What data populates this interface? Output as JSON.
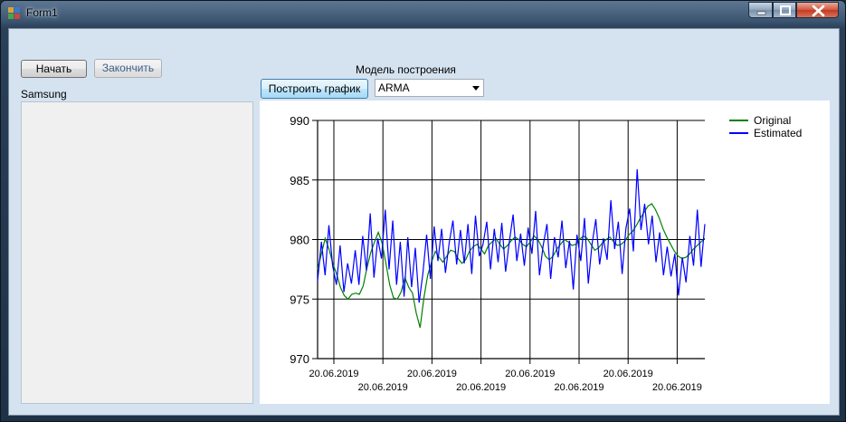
{
  "window": {
    "title": "Form1"
  },
  "buttons": {
    "start": "Начать",
    "finish": "Закончить",
    "plot": "Построить график"
  },
  "labels": {
    "list_title": "Samsung",
    "model_label": "Модель построения"
  },
  "model_select": {
    "value": "ARMA"
  },
  "colors": {
    "original": "#008000",
    "estimated": "#0000ff"
  },
  "chart_data": {
    "type": "line",
    "ylim": [
      970,
      990
    ],
    "yticks": [
      "970",
      "975",
      "980",
      "985",
      "990"
    ],
    "xtick_labels": [
      "20.06.2019",
      "20.06.2019",
      "20.06.2019",
      "20.06.2019",
      "20.06.2019",
      "20.06.2019",
      "20.06.2019",
      "20.06.2019"
    ],
    "legend": [
      "Original",
      "Estimated"
    ],
    "legend_position": "top-right",
    "grid": true,
    "series": [
      {
        "name": "Original",
        "values": [
          977.5,
          978.8,
          980.1,
          979.2,
          978.0,
          977.1,
          976.0,
          975.3,
          975.0,
          975.4,
          975.5,
          975.4,
          976.1,
          977.6,
          978.9,
          979.8,
          980.6,
          979.7,
          978.0,
          976.2,
          975.1,
          975.0,
          975.6,
          976.8,
          976.0,
          975.5,
          973.8,
          972.6,
          975.1,
          977.0,
          978.1,
          979.0,
          978.5,
          978.1,
          978.6,
          979.1,
          979.0,
          978.4,
          978.0,
          978.3,
          979.0,
          979.4,
          979.6,
          979.2,
          978.8,
          979.5,
          979.8,
          980.1,
          979.6,
          979.2,
          979.5,
          979.9,
          980.2,
          980.0,
          979.6,
          979.4,
          979.8,
          980.3,
          980.0,
          979.4,
          978.6,
          978.3,
          978.6,
          979.2,
          979.6,
          980.0,
          979.8,
          979.5,
          979.6,
          980.0,
          980.3,
          980.1,
          979.6,
          979.1,
          979.3,
          979.7,
          980.0,
          980.2,
          979.8,
          979.5,
          979.6,
          979.9,
          980.4,
          980.7,
          981.2,
          981.8,
          982.3,
          982.8,
          983.0,
          982.5,
          981.8,
          980.9,
          980.2,
          979.6,
          979.0,
          978.6,
          978.4,
          978.5,
          978.8,
          979.2,
          979.5,
          979.8,
          980.1
        ]
      },
      {
        "name": "Estimated",
        "values": [
          976.5,
          979.8,
          977.0,
          981.2,
          977.8,
          976.2,
          979.5,
          975.6,
          978.0,
          976.3,
          979.1,
          976.2,
          980.3,
          977.4,
          982.2,
          976.8,
          980.1,
          978.4,
          982.5,
          977.5,
          981.6,
          976.2,
          979.8,
          975.2,
          980.2,
          976.0,
          979.3,
          974.7,
          977.1,
          980.4,
          976.7,
          981.1,
          978.2,
          980.9,
          977.2,
          979.7,
          981.6,
          977.9,
          980.8,
          978.0,
          981.3,
          977.1,
          982.0,
          978.6,
          979.6,
          981.5,
          977.5,
          980.9,
          978.1,
          981.4,
          977.3,
          979.8,
          982.1,
          978.2,
          980.5,
          977.8,
          981.0,
          978.8,
          982.4,
          977.0,
          979.5,
          981.3,
          976.7,
          980.2,
          978.5,
          981.6,
          977.6,
          979.9,
          975.8,
          980.4,
          978.2,
          981.8,
          976.3,
          979.6,
          981.7,
          977.9,
          980.1,
          978.3,
          983.3,
          979.2,
          981.5,
          977.1,
          980.9,
          982.6,
          979.0,
          985.9,
          980.8,
          983.0,
          979.6,
          982.0,
          978.1,
          980.6,
          977.0,
          979.4,
          976.9,
          978.8,
          975.3,
          978.5,
          976.4,
          980.3,
          977.8,
          982.5,
          977.7,
          981.3
        ]
      }
    ]
  }
}
